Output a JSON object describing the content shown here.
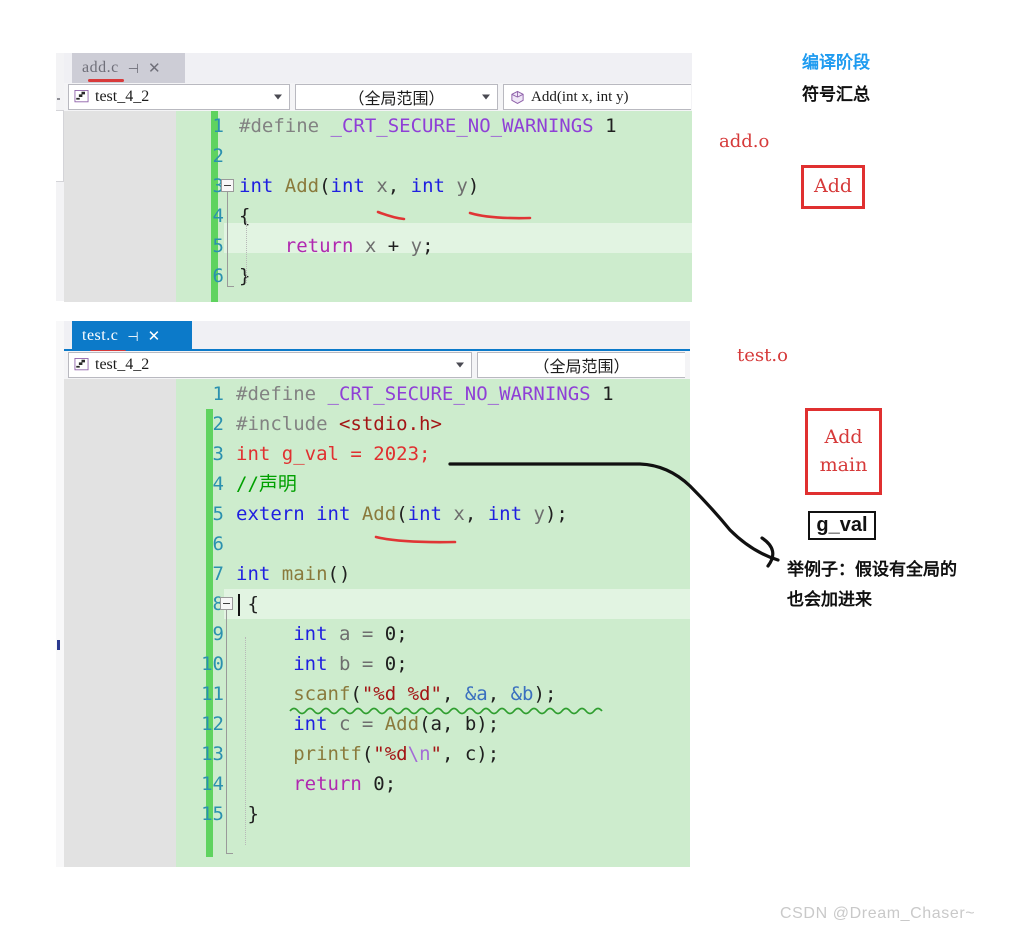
{
  "meta": {
    "watermark": "CSDN @Dream_Chaser~"
  },
  "editors": [
    {
      "id": "add-c",
      "tab": {
        "label": "add.c",
        "pin_icon": "pin-icon",
        "close_icon": "close-icon",
        "active": false
      },
      "navbar": {
        "project_combo": {
          "value": "test_4_2",
          "icon": "project-icon"
        },
        "scope_combo": {
          "value": "（全局范围）"
        },
        "member_combo": {
          "value": "Add(int x, int y)",
          "icon": "method-cube-icon"
        }
      },
      "lines": [
        {
          "n": "1",
          "tokens": [
            {
              "t": "#define ",
              "c": "pre"
            },
            {
              "t": "_CRT_SECURE_NO_WARNINGS",
              "c": "macro"
            },
            {
              "t": " ",
              "c": "pun"
            },
            {
              "t": "1",
              "c": "num2"
            }
          ]
        },
        {
          "n": "2",
          "tokens": []
        },
        {
          "n": "3",
          "tokens": [
            {
              "t": "int ",
              "c": "kw"
            },
            {
              "t": "Add",
              "c": "fn"
            },
            {
              "t": "(",
              "c": "pun"
            },
            {
              "t": "int",
              "c": "kw"
            },
            {
              "t": " x",
              "c": "var"
            },
            {
              "t": ", ",
              "c": "pun"
            },
            {
              "t": "int",
              "c": "kw"
            },
            {
              "t": " y",
              "c": "var"
            },
            {
              "t": ")",
              "c": "pun"
            }
          ]
        },
        {
          "n": "4",
          "tokens": [
            {
              "t": "{",
              "c": "pun"
            }
          ]
        },
        {
          "n": "5",
          "tokens": [
            {
              "t": "    ",
              "c": "pun"
            },
            {
              "t": "return",
              "c": "ret"
            },
            {
              "t": " x ",
              "c": "var"
            },
            {
              "t": "+",
              "c": "pun"
            },
            {
              "t": " y",
              "c": "var"
            },
            {
              "t": ";",
              "c": "pun"
            }
          ]
        },
        {
          "n": "6",
          "tokens": [
            {
              "t": "}",
              "c": "pun"
            }
          ]
        }
      ]
    },
    {
      "id": "test-c",
      "tab": {
        "label": "test.c",
        "pin_icon": "pin-icon",
        "close_icon": "close-icon",
        "active": true
      },
      "navbar": {
        "project_combo": {
          "value": "test_4_2",
          "icon": "project-icon"
        },
        "scope_combo": {
          "value": "（全局范围）"
        }
      },
      "lines": [
        {
          "n": "1",
          "tokens": [
            {
              "t": "#define ",
              "c": "pre"
            },
            {
              "t": "_CRT_SECURE_NO_WARNINGS",
              "c": "macro"
            },
            {
              "t": " ",
              "c": "pun"
            },
            {
              "t": "1",
              "c": "num2"
            }
          ]
        },
        {
          "n": "2",
          "tokens": [
            {
              "t": "#include ",
              "c": "pre"
            },
            {
              "t": "<stdio.h>",
              "c": "inc"
            }
          ]
        },
        {
          "n": "3",
          "tokens": [
            {
              "t": "int g_val = 2023;",
              "c": "red"
            }
          ]
        },
        {
          "n": "4",
          "tokens": [
            {
              "t": "//声明",
              "c": "cmt"
            }
          ]
        },
        {
          "n": "5",
          "tokens": [
            {
              "t": "extern int ",
              "c": "kw"
            },
            {
              "t": "Add",
              "c": "fn"
            },
            {
              "t": "(",
              "c": "pun"
            },
            {
              "t": "int",
              "c": "kw"
            },
            {
              "t": " x",
              "c": "var"
            },
            {
              "t": ", ",
              "c": "pun"
            },
            {
              "t": "int",
              "c": "kw"
            },
            {
              "t": " y",
              "c": "var"
            },
            {
              "t": ");",
              "c": "pun"
            }
          ]
        },
        {
          "n": "6",
          "tokens": []
        },
        {
          "n": "7",
          "tokens": [
            {
              "t": "int ",
              "c": "kw"
            },
            {
              "t": "main",
              "c": "fn"
            },
            {
              "t": "()",
              "c": "pun"
            }
          ]
        },
        {
          "n": "8",
          "tokens": [
            {
              "t": " {",
              "c": "pun"
            }
          ]
        },
        {
          "n": "9",
          "tokens": [
            {
              "t": "     ",
              "c": "pun"
            },
            {
              "t": "int",
              "c": "kw"
            },
            {
              "t": " a = ",
              "c": "var"
            },
            {
              "t": "0",
              "c": "num2"
            },
            {
              "t": ";",
              "c": "pun"
            }
          ]
        },
        {
          "n": "10",
          "tokens": [
            {
              "t": "     ",
              "c": "pun"
            },
            {
              "t": "int",
              "c": "kw"
            },
            {
              "t": " b = ",
              "c": "var"
            },
            {
              "t": "0",
              "c": "num2"
            },
            {
              "t": ";",
              "c": "pun"
            }
          ]
        },
        {
          "n": "11",
          "tokens": [
            {
              "t": "     ",
              "c": "pun"
            },
            {
              "t": "scanf",
              "c": "fn"
            },
            {
              "t": "(",
              "c": "pun"
            },
            {
              "t": "\"%d %d\"",
              "c": "str"
            },
            {
              "t": ", ",
              "c": "pun"
            },
            {
              "t": "&a",
              "c": "amp"
            },
            {
              "t": ", ",
              "c": "pun"
            },
            {
              "t": "&b",
              "c": "amp"
            },
            {
              "t": ");",
              "c": "pun"
            }
          ]
        },
        {
          "n": "12",
          "tokens": [
            {
              "t": "     ",
              "c": "pun"
            },
            {
              "t": "int",
              "c": "kw"
            },
            {
              "t": " c = ",
              "c": "var"
            },
            {
              "t": "Add",
              "c": "fn"
            },
            {
              "t": "(a, b);",
              "c": "pun"
            }
          ]
        },
        {
          "n": "13",
          "tokens": [
            {
              "t": "     ",
              "c": "pun"
            },
            {
              "t": "printf",
              "c": "fn"
            },
            {
              "t": "(",
              "c": "pun"
            },
            {
              "t": "\"%d",
              "c": "str"
            },
            {
              "t": "\\n",
              "c": "esc"
            },
            {
              "t": "\"",
              "c": "str"
            },
            {
              "t": ", c);",
              "c": "pun"
            }
          ]
        },
        {
          "n": "14",
          "tokens": [
            {
              "t": "     ",
              "c": "pun"
            },
            {
              "t": "return",
              "c": "ret"
            },
            {
              "t": " ",
              "c": "pun"
            },
            {
              "t": "0",
              "c": "num2"
            },
            {
              "t": ";",
              "c": "pun"
            }
          ]
        },
        {
          "n": "15",
          "tokens": [
            {
              "t": " }",
              "c": "pun"
            }
          ]
        }
      ]
    }
  ],
  "annotations": {
    "stage_title": "编译阶段",
    "stage_subtitle": "符号汇总",
    "obj_add": "add.o",
    "obj_test": "test.o",
    "box_add_symbols": "Add",
    "box_test_symbols_line1": "Add",
    "box_test_symbols_line2": "main",
    "box_gval": "g_val",
    "note_line1": "举例子：假设有全局的",
    "note_line2": "也会加进来"
  },
  "colors": {
    "accent_blue": "#1e9bf0",
    "annotation_red": "#d63a3a",
    "box_red": "#e03030",
    "code_bg": "#cdeccd",
    "changebar_green": "#5fd35f",
    "active_tab_blue": "#0c7ac9"
  }
}
